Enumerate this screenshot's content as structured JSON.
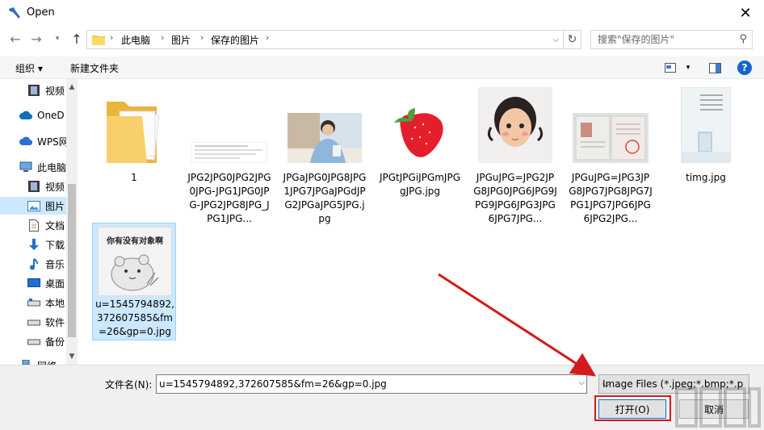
{
  "window": {
    "title": "Open",
    "close_icon": "close-icon"
  },
  "address": {
    "crumbs": [
      "此电脑",
      "图片",
      "保存的图片"
    ],
    "separator": "›"
  },
  "search": {
    "placeholder": "搜索\"保存的图片\""
  },
  "toolbar": {
    "organize": "组织 ▾",
    "new_folder": "新建文件夹"
  },
  "sidebar": {
    "items": [
      {
        "label": "视频",
        "icon": "video-icon"
      },
      {
        "label": "OneD",
        "icon": "cloud-icon"
      },
      {
        "label": "WPS网",
        "icon": "cloud-icon"
      },
      {
        "label": "此电脑",
        "icon": "computer-icon"
      },
      {
        "label": "视频",
        "icon": "video-icon"
      },
      {
        "label": "图片",
        "icon": "pictures-icon",
        "selected": true
      },
      {
        "label": "文档",
        "icon": "document-icon"
      },
      {
        "label": "下载",
        "icon": "download-icon"
      },
      {
        "label": "音乐",
        "icon": "music-icon"
      },
      {
        "label": "桌面",
        "icon": "desktop-icon"
      },
      {
        "label": "本地",
        "icon": "drive-icon"
      },
      {
        "label": "软件",
        "icon": "drive-icon"
      },
      {
        "label": "备份",
        "icon": "drive-icon"
      },
      {
        "label": "网络",
        "icon": "network-icon"
      }
    ]
  },
  "files": [
    {
      "name": "1"
    },
    {
      "name": "JPG2JPG0JPG2JPG0JPG-JPG1JPG0JPG-JPG2JPG8JPG_JPG1JPG..."
    },
    {
      "name": "JPGaJPG0JPG8JPG1JPG7JPGaJPGdJPG2JPGaJPG5JPG.jpg"
    },
    {
      "name": "JPGtJPGiJPGmJPGgJPG.jpg"
    },
    {
      "name": "JPGuJPG=JPG2JPG8JPG0JPG6JPG9JPG9JPG6JPG3JPG6JPG7JPG..."
    },
    {
      "name": "JPGuJPG=JPG3JPG8JPG7JPG8JPG7JPG1JPG7JPG6JPG6JPG2JPG..."
    },
    {
      "name": "timg.jpg"
    },
    {
      "name": "u=1545794892,372607585&fm=26&gp=0.jpg",
      "thumb_text": "你有没有对象啊"
    }
  ],
  "bottom": {
    "filename_label": "文件名(N):",
    "filename_value": "u=1545794892,372607585&fm=26&gp=0.jpg",
    "file_type": "Image Files (*.jpeg;*.bmp;*.p",
    "open_button": "打开(O)",
    "cancel_button": "取消"
  },
  "colors": {
    "accent": "#1366c6",
    "selection": "#cce8ff",
    "highlight": "#d41a1a"
  }
}
